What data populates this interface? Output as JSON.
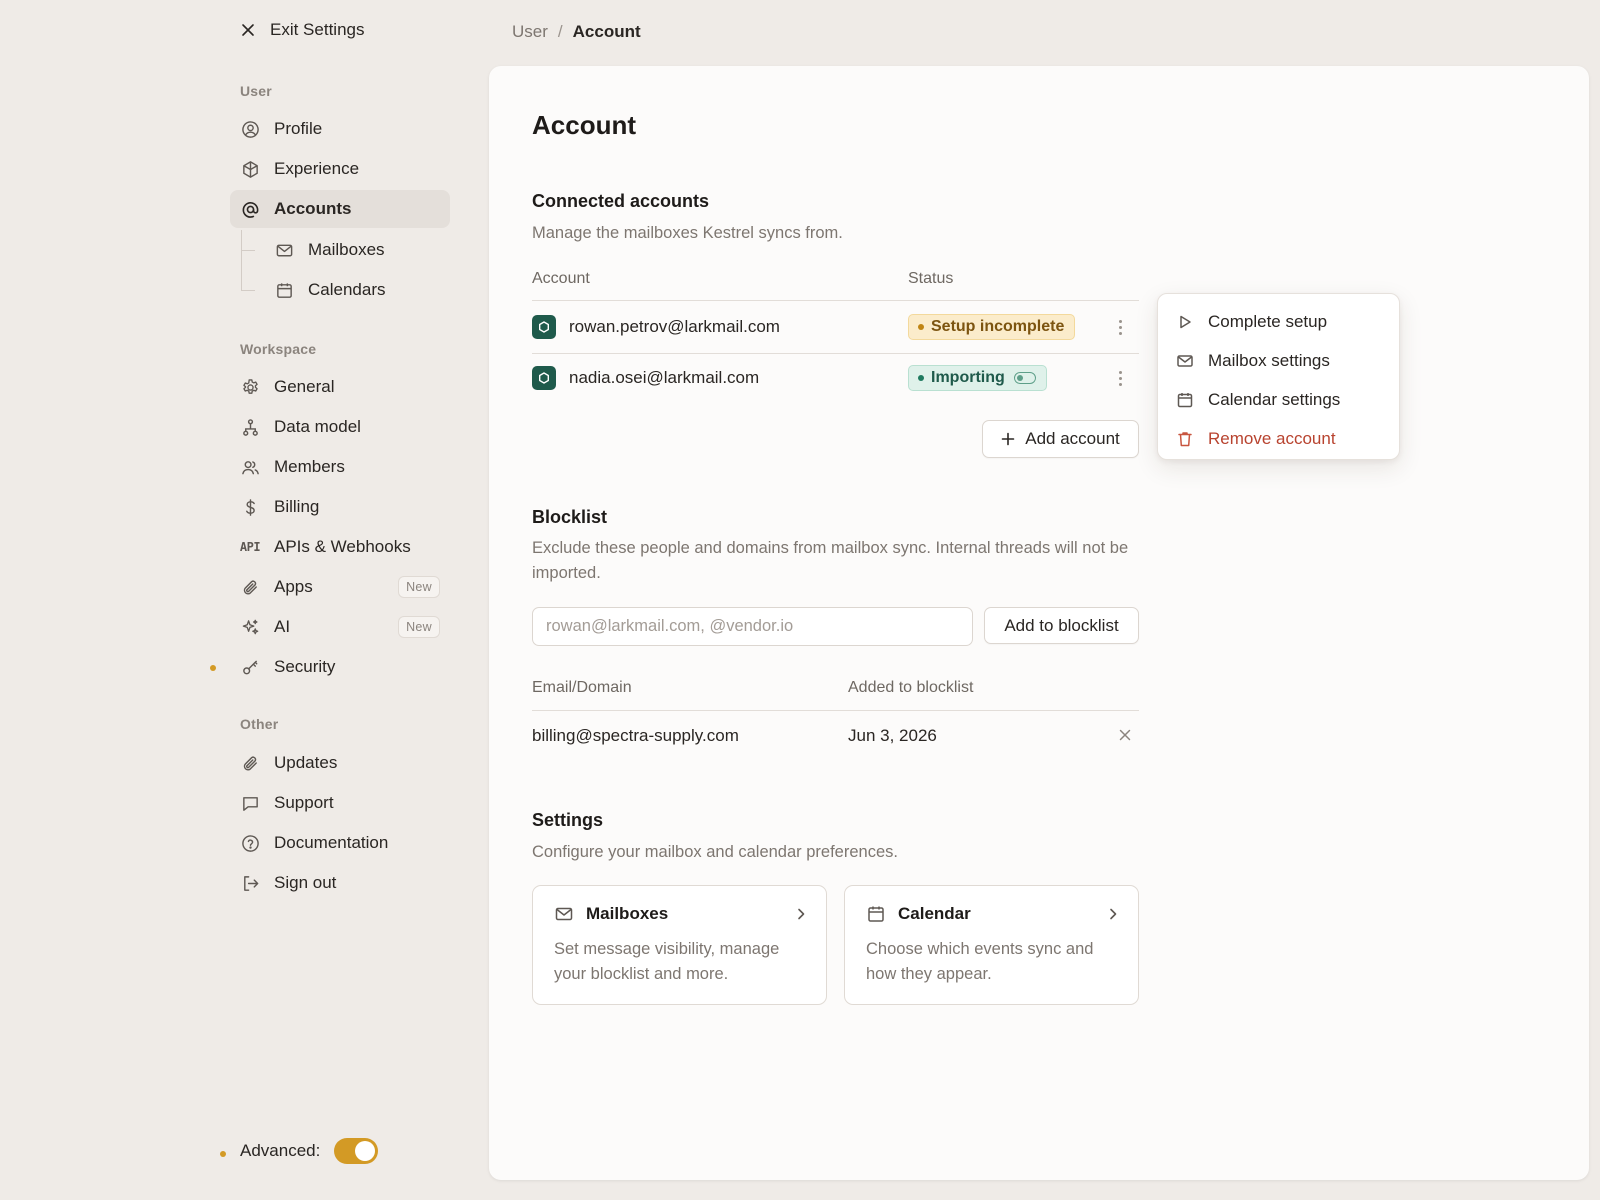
{
  "sidebar": {
    "exit_label": "Exit Settings",
    "groups": {
      "user": "User",
      "workspace": "Workspace",
      "other": "Other"
    },
    "user_items": {
      "profile": "Profile",
      "experience": "Experience",
      "accounts": "Accounts",
      "mailboxes": "Mailboxes",
      "calendars": "Calendars"
    },
    "workspace_items": {
      "general": "General",
      "data_model": "Data model",
      "members": "Members",
      "billing": "Billing",
      "apis": "APIs & Webhooks",
      "apps": "Apps",
      "ai": "AI",
      "security": "Security"
    },
    "apps_badge": "New",
    "ai_badge": "New",
    "other_items": {
      "updates": "Updates",
      "support": "Support",
      "documentation": "Documentation",
      "sign_out": "Sign out"
    },
    "advanced_label": "Advanced:",
    "advanced_on": true,
    "api_icon_text": "API"
  },
  "breadcrumb": {
    "parent": "User",
    "separator": "/",
    "current": "Account"
  },
  "page": {
    "title": "Account"
  },
  "connected": {
    "title": "Connected accounts",
    "description": "Manage the mailboxes Kestrel syncs from.",
    "col_account": "Account",
    "col_status": "Status",
    "rows": [
      {
        "email": "rowan.petrov@larkmail.com",
        "status": "Setup incomplete"
      },
      {
        "email": "nadia.osei@larkmail.com",
        "status": "Importing"
      }
    ],
    "add_button": "Add account"
  },
  "blocklist": {
    "title": "Blocklist",
    "description": "Exclude these people and domains from mailbox sync. Internal threads will not be imported.",
    "input_placeholder": "rowan@larkmail.com, @vendor.io",
    "input_value": "",
    "add_button": "Add to blocklist",
    "col_email": "Email/Domain",
    "col_added": "Added to blocklist",
    "rows": [
      {
        "email": "billing@spectra-supply.com",
        "added": "Jun 3, 2026"
      }
    ]
  },
  "settings": {
    "title": "Settings",
    "description": "Configure your mailbox and calendar preferences.",
    "cards": [
      {
        "title": "Mailboxes",
        "description": "Set message visibility, manage your blocklist and more."
      },
      {
        "title": "Calendar",
        "description": "Choose which events sync and how they appear."
      }
    ]
  },
  "menu": {
    "items": {
      "complete_setup": "Complete setup",
      "mailbox_settings": "Mailbox settings",
      "calendar_settings": "Calendar settings",
      "remove_account": "Remove account"
    }
  },
  "colors": {
    "accent": "#d39a25",
    "account_logo": "#1f5a4b",
    "danger": "#b8432f",
    "warn_badge_bg": "#fbeccb",
    "ok_badge_bg": "#dff1ea"
  }
}
